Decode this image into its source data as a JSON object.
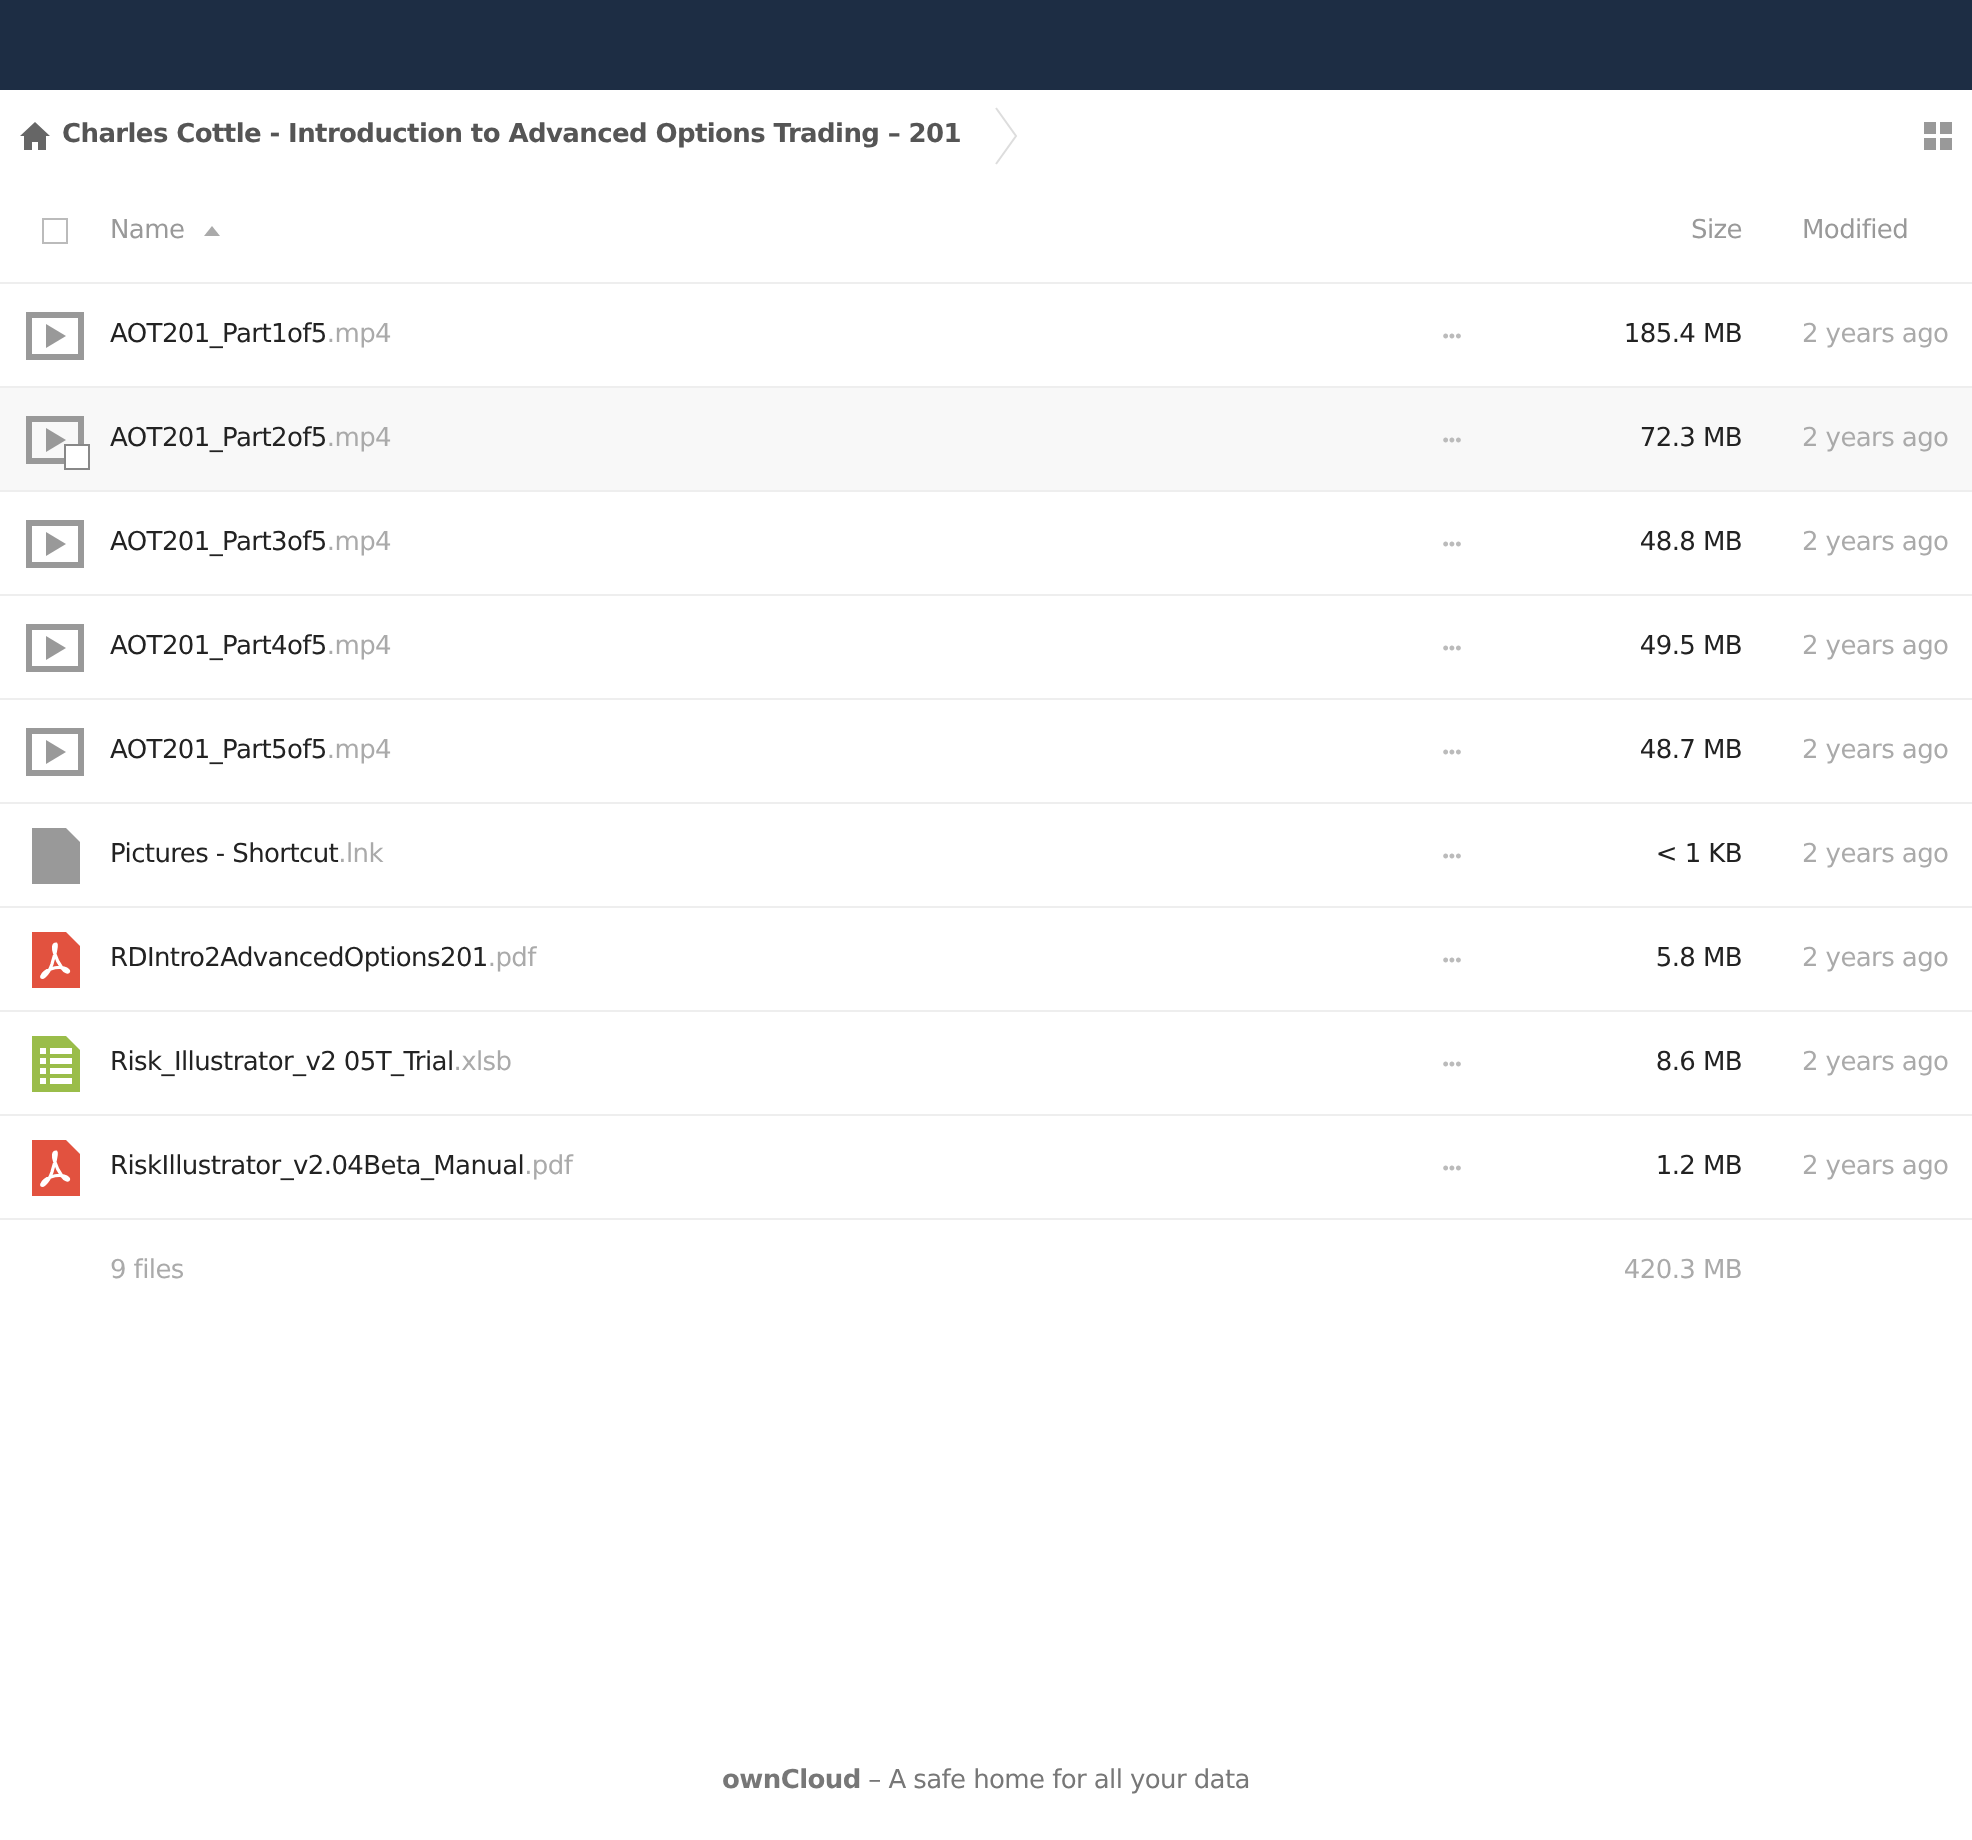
{
  "breadcrumb": {
    "path": "Charles Cottle - Introduction to Advanced Options Trading – 201"
  },
  "table": {
    "columns": {
      "name": "Name",
      "size": "Size",
      "modified": "Modified"
    },
    "select_all": {
      "checked": false
    },
    "rows": [
      {
        "kind": "video",
        "name": "AOT201_Part1of5",
        "ext": ".mp4",
        "menu": "•••",
        "size": "185.4 MB",
        "modified": "2 years ago",
        "hovered": false
      },
      {
        "kind": "video",
        "name": "AOT201_Part2of5",
        "ext": ".mp4",
        "menu": "•••",
        "size": "72.3 MB",
        "modified": "2 years ago",
        "hovered": true
      },
      {
        "kind": "video",
        "name": "AOT201_Part3of5",
        "ext": ".mp4",
        "menu": "•••",
        "size": "48.8 MB",
        "modified": "2 years ago",
        "hovered": false
      },
      {
        "kind": "video",
        "name": "AOT201_Part4of5",
        "ext": ".mp4",
        "menu": "•••",
        "size": "49.5 MB",
        "modified": "2 years ago",
        "hovered": false
      },
      {
        "kind": "video",
        "name": "AOT201_Part5of5",
        "ext": ".mp4",
        "menu": "•••",
        "size": "48.7 MB",
        "modified": "2 years ago",
        "hovered": false
      },
      {
        "kind": "file",
        "name": "Pictures - Shortcut",
        "ext": ".lnk",
        "menu": "•••",
        "size": "< 1 KB",
        "modified": "2 years ago",
        "hovered": false
      },
      {
        "kind": "pdf",
        "name": "RDIntro2AdvancedOptions201",
        "ext": ".pdf",
        "menu": "•••",
        "size": "5.8 MB",
        "modified": "2 years ago",
        "hovered": false
      },
      {
        "kind": "spreadsheet",
        "name": "Risk_Illustrator_v2 05T_Trial",
        "ext": ".xlsb",
        "menu": "•••",
        "size": "8.6 MB",
        "modified": "2 years ago",
        "hovered": false
      },
      {
        "kind": "pdf",
        "name": "RiskIllustrator_v2.04Beta_Manual",
        "ext": ".pdf",
        "menu": "•••",
        "size": "1.2 MB",
        "modified": "2 years ago",
        "hovered": false
      }
    ],
    "summary": {
      "count": "9 files",
      "size": "420.3 MB"
    }
  },
  "footer": "**ownCloud** – A safe home for all your data"
}
